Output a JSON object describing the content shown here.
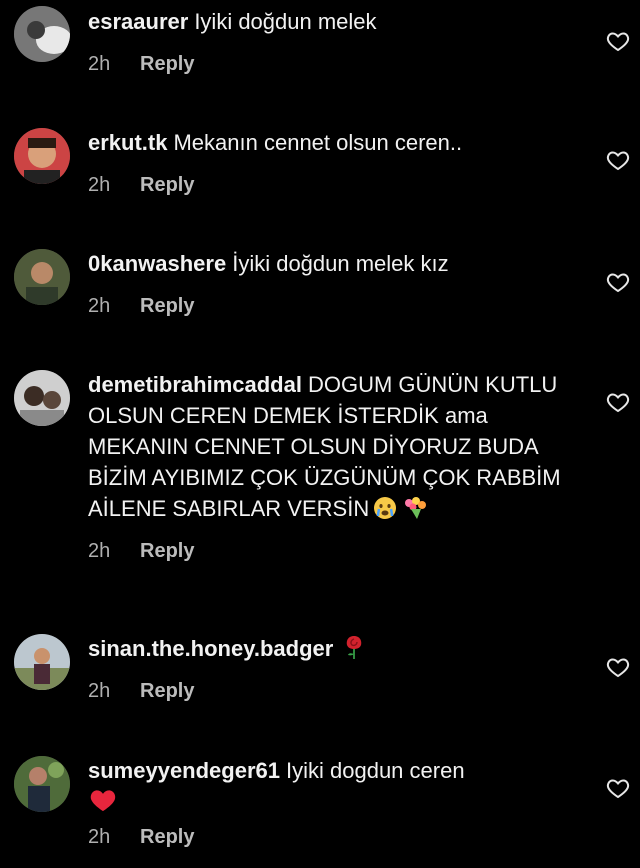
{
  "comments": [
    {
      "username": "esraaurer",
      "text": "Iyiki doğdun melek",
      "time": "2h",
      "reply": "Reply"
    },
    {
      "username": "erkut.tk",
      "text": "Mekanın cennet olsun ceren..",
      "time": "2h",
      "reply": "Reply"
    },
    {
      "username": "0kanwashere",
      "text": "İyiki doğdun melek kız",
      "time": "2h",
      "reply": "Reply"
    },
    {
      "username": "demetibrahimcaddal",
      "text": "DOGUM GÜNÜN KUTLU OLSUN CEREN DEMEK İSTERDİK ama MEKANIN CENNET OLSUN DİYORUZ BUDA BİZİM AYIBIMIZ ÇOK ÜZGÜNÜM ÇOK RABBİM AİLENE SABIRLAR VERSİN",
      "emojis": [
        "crying-face",
        "bouquet"
      ],
      "time": "2h",
      "reply": "Reply"
    },
    {
      "username": "sinan.the.honey.badger",
      "text": "",
      "emojis": [
        "rose"
      ],
      "time": "2h",
      "reply": "Reply"
    },
    {
      "username": "sumeyyendeger61",
      "text": "Iyiki dogdun ceren",
      "emojis": [
        "red-heart"
      ],
      "time": "2h",
      "reply": "Reply"
    }
  ],
  "colors": {
    "background": "#000000",
    "text": "#f2f2f2",
    "meta": "#b0b0b0"
  }
}
